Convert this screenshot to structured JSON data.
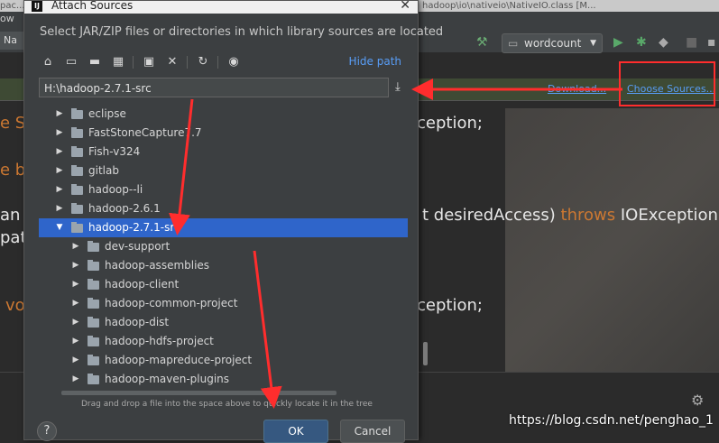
{
  "ide": {
    "title_left": "pac...",
    "title_right": "hadoop\\io\\nativeio\\NativeIO.class [M...",
    "menu_text": "ow",
    "tab_label": "Na",
    "run_config": "wordcount",
    "download_link": "Download...",
    "choose_sources_link": "Choose Sources...",
    "code": {
      "l1_left": "e S",
      "l1_right": "ception;",
      "l2_left": "e b",
      "l3_left": "an a",
      "l3_right_a": "t desiredAccess) ",
      "l3_right_kw": "throws",
      "l3_right_b": " IOException",
      "l4_left": "path",
      "l5_left": "vo",
      "l5_right": "ception;"
    },
    "watermark": "https://blog.csdn.net/penghao_1"
  },
  "dialog": {
    "title": "Attach Sources",
    "description": "Select JAR/ZIP files or directories in which library sources are located",
    "hide_path": "Hide path",
    "path_value": "H:\\hadoop-2.7.1-src",
    "tree": [
      {
        "label": "eclipse",
        "expanded": false,
        "selected": false,
        "level": 0
      },
      {
        "label": "FastStoneCapture7.7",
        "expanded": false,
        "selected": false,
        "level": 0
      },
      {
        "label": "Fish-v324",
        "expanded": false,
        "selected": false,
        "level": 0
      },
      {
        "label": "gitlab",
        "expanded": false,
        "selected": false,
        "level": 0
      },
      {
        "label": "hadoop--li",
        "expanded": false,
        "selected": false,
        "level": 0
      },
      {
        "label": "hadoop-2.6.1",
        "expanded": false,
        "selected": false,
        "level": 0
      },
      {
        "label": "hadoop-2.7.1-src",
        "expanded": true,
        "selected": true,
        "level": 0
      },
      {
        "label": "dev-support",
        "expanded": false,
        "selected": false,
        "level": 1
      },
      {
        "label": "hadoop-assemblies",
        "expanded": false,
        "selected": false,
        "level": 1
      },
      {
        "label": "hadoop-client",
        "expanded": false,
        "selected": false,
        "level": 1
      },
      {
        "label": "hadoop-common-project",
        "expanded": false,
        "selected": false,
        "level": 1
      },
      {
        "label": "hadoop-dist",
        "expanded": false,
        "selected": false,
        "level": 1
      },
      {
        "label": "hadoop-hdfs-project",
        "expanded": false,
        "selected": false,
        "level": 1
      },
      {
        "label": "hadoop-mapreduce-project",
        "expanded": false,
        "selected": false,
        "level": 1
      },
      {
        "label": "hadoop-maven-plugins",
        "expanded": false,
        "selected": false,
        "level": 1
      }
    ],
    "drag_hint": "Drag and drop a file into the space above to quickly locate it in the tree",
    "ok_label": "OK",
    "cancel_label": "Cancel",
    "help_label": "?"
  },
  "colors": {
    "annotation": "#ff2d2d",
    "selection": "#2f65ca",
    "link": "#589df6"
  }
}
